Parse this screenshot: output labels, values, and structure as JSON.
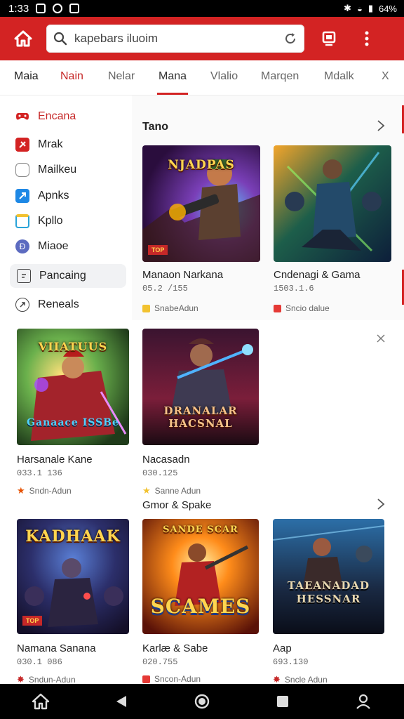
{
  "status_bar": {
    "time": "1:33",
    "battery": "64%"
  },
  "header": {
    "search_text": "kapebars iluoim"
  },
  "tabs": [
    {
      "label": "Maia"
    },
    {
      "label": "Nain"
    },
    {
      "label": "Nelar"
    },
    {
      "label": "Mana"
    },
    {
      "label": "Vlalio"
    },
    {
      "label": "Marqen"
    },
    {
      "label": "Mdalk"
    },
    {
      "label": "X"
    }
  ],
  "sidebar": {
    "items": [
      {
        "label": "Encana",
        "icon": "controller-icon"
      },
      {
        "label": "Mrak",
        "icon": "bookmark-icon"
      },
      {
        "label": "Mailkeu",
        "icon": "circle-icon"
      },
      {
        "label": "Apnks",
        "icon": "apps-icon"
      },
      {
        "label": "Kpllo",
        "icon": "folder-icon"
      },
      {
        "label": "Miaoe",
        "icon": "badge-icon"
      },
      {
        "label": "Pancaing",
        "icon": "document-icon"
      },
      {
        "label": "Reneals",
        "icon": "refresh-icon"
      }
    ]
  },
  "sections": {
    "first_title": "Tano",
    "second_title": "Gmor & Spake"
  },
  "cards": [
    {
      "title": "Manaon Narkana",
      "meta": "05.2 /155",
      "developer": "SnabeAdun",
      "thumb_text": "NJADPAS",
      "badge": "TOP"
    },
    {
      "title": "Cndenagi & Gama",
      "meta": "1503.1.6",
      "developer": "Sncio dalue",
      "thumb_text": ""
    },
    {
      "title": "Harsanale Kane",
      "meta": "033.1 136",
      "developer": "Sndn-Adun",
      "thumb_text": "VIIATUUS",
      "thumb_sub": "Ganaace ISSBe"
    },
    {
      "title": "Nacasadn",
      "meta": "030.125",
      "developer": "Sanne Adun",
      "thumb_text": "DRANALAR HACSNAL"
    },
    {
      "title": "Namana Sanana",
      "meta": "030.1 086",
      "developer": "Sndun-Adun",
      "thumb_text": "KADHAAK",
      "badge": "TOP"
    },
    {
      "title": "Karlæ & Sabe",
      "meta": "020.755",
      "developer": "Sncon-Adun",
      "thumb_text": "SCAMES",
      "thumb_top": "SANDE SCAR"
    },
    {
      "title": "Aap",
      "meta": "693.130",
      "developer": "Sncle Adun",
      "thumb_text": "TAEANADAD HESSNAR"
    }
  ],
  "colors": {
    "brand": "#d32323",
    "accent_yellow": "#f2c230"
  }
}
